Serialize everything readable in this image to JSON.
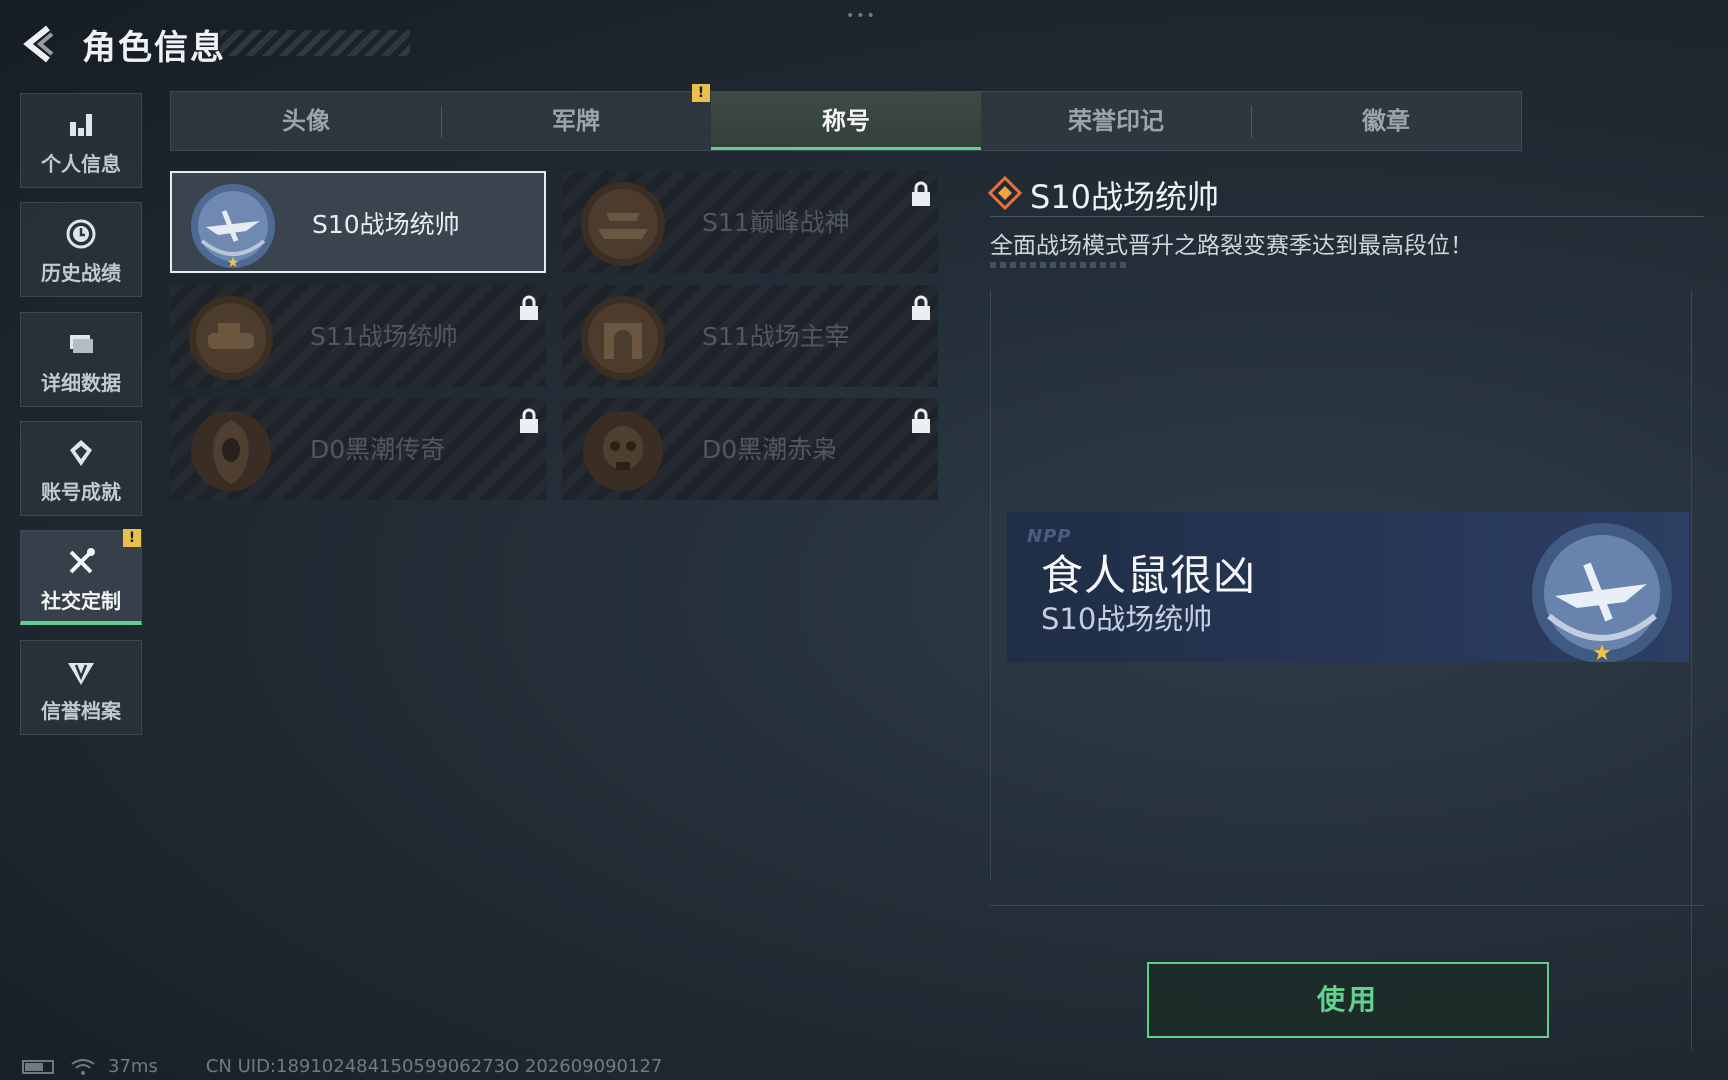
{
  "header": {
    "title": "角色信息",
    "back_icon": "back-arrow-icon"
  },
  "sidebar": {
    "items": [
      {
        "label": "个人信息",
        "icon": "bar-chart-icon",
        "active": false
      },
      {
        "label": "历史战绩",
        "icon": "clock-icon",
        "active": false
      },
      {
        "label": "详细数据",
        "icon": "folder-icon",
        "active": false
      },
      {
        "label": "账号成就",
        "icon": "achievement-icon",
        "active": false
      },
      {
        "label": "社交定制",
        "icon": "wrench-screwdriver-icon",
        "active": true,
        "alert": "!"
      },
      {
        "label": "信誉档案",
        "icon": "shield-wing-icon",
        "active": false
      }
    ]
  },
  "tabs": [
    {
      "label": "头像",
      "active": false
    },
    {
      "label": "军牌",
      "active": false,
      "alert": "!"
    },
    {
      "label": "称号",
      "active": true
    },
    {
      "label": "荣誉印记",
      "active": false
    },
    {
      "label": "徽章",
      "active": false
    }
  ],
  "titles": [
    {
      "name": "S10战场统帅",
      "selected": true,
      "locked": false,
      "medal": "aircraft-medal"
    },
    {
      "name": "S11巅峰战神",
      "selected": false,
      "locked": true,
      "medal": "hovercraft-medal"
    },
    {
      "name": "S11战场统帅",
      "selected": false,
      "locked": true,
      "medal": "tank-medal"
    },
    {
      "name": "S11战场主宰",
      "selected": false,
      "locked": true,
      "medal": "arch-medal"
    },
    {
      "name": "D0黑潮传奇",
      "selected": false,
      "locked": true,
      "medal": "hooded-figure-medal"
    },
    {
      "name": "D0黑潮赤枭",
      "selected": false,
      "locked": true,
      "medal": "skull-medal"
    }
  ],
  "detail": {
    "title": "S10战场统帅",
    "description": "全面战场模式晋升之路裂变赛季达到最高段位！"
  },
  "namecard": {
    "logo": "NPP",
    "player_name": "食人鼠很凶",
    "title": "S10战场统帅"
  },
  "actions": {
    "use_label": "使用"
  },
  "status": {
    "ping": "37ms",
    "uid": "CN UID:18910248415059906273O 202609090127"
  },
  "colors": {
    "accent": "#5fd08a",
    "alert": "#e8c14a"
  }
}
